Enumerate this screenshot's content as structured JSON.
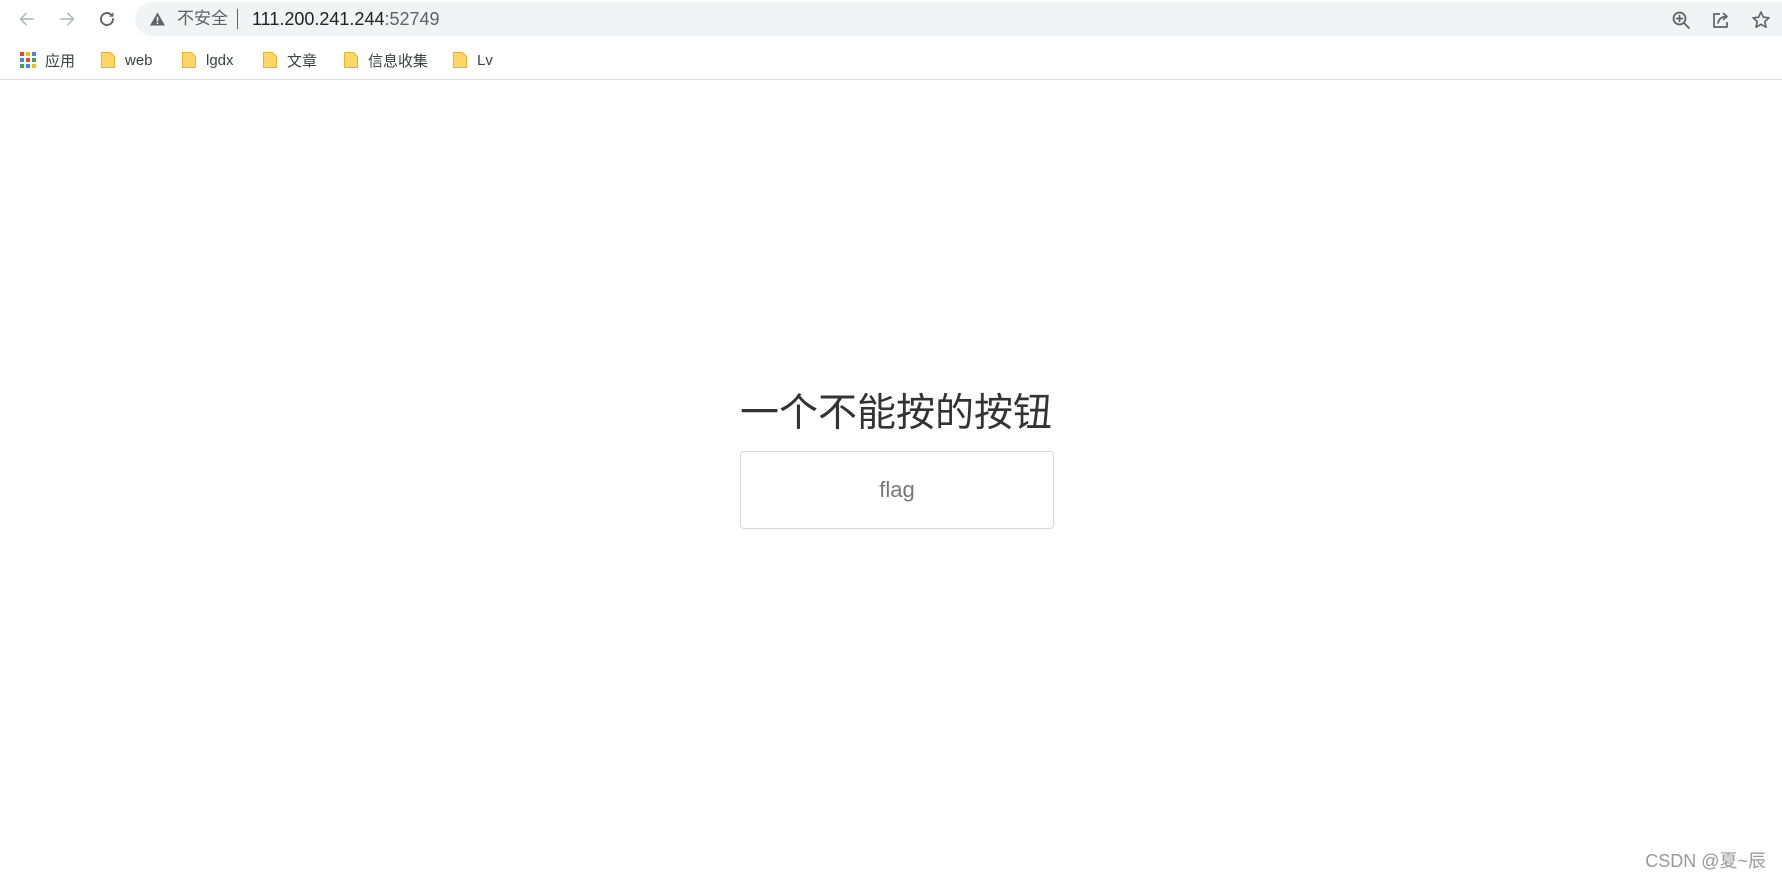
{
  "browser": {
    "security_label": "不安全",
    "url_host": "111.200.241.244",
    "url_port": ":52749",
    "icons": {
      "back": "arrow-left-icon",
      "forward": "arrow-right-icon",
      "reload": "reload-icon",
      "warning": "warning-triangle-icon",
      "zoom": "zoom-in-icon",
      "share": "share-icon",
      "bookmark_star": "star-icon"
    }
  },
  "bookmarks": [
    {
      "label": "应用",
      "icon": "apps-grid-icon"
    },
    {
      "label": "web",
      "icon": "folder-icon"
    },
    {
      "label": "lgdx",
      "icon": "folder-icon"
    },
    {
      "label": "文章",
      "icon": "folder-icon"
    },
    {
      "label": "信息收集",
      "icon": "folder-icon"
    },
    {
      "label": "Lv",
      "icon": "folder-icon"
    }
  ],
  "page": {
    "title": "一个不能按的按钮",
    "button_label": "flag"
  },
  "watermark": "CSDN @夏~辰",
  "colors": {
    "folder": "#fdd663",
    "folder_stroke": "#e8b330",
    "icon_gray": "#5f6368",
    "omnibox_bg": "#f1f3f4",
    "button_border": "#d6d9dc",
    "title_text": "#333333"
  }
}
